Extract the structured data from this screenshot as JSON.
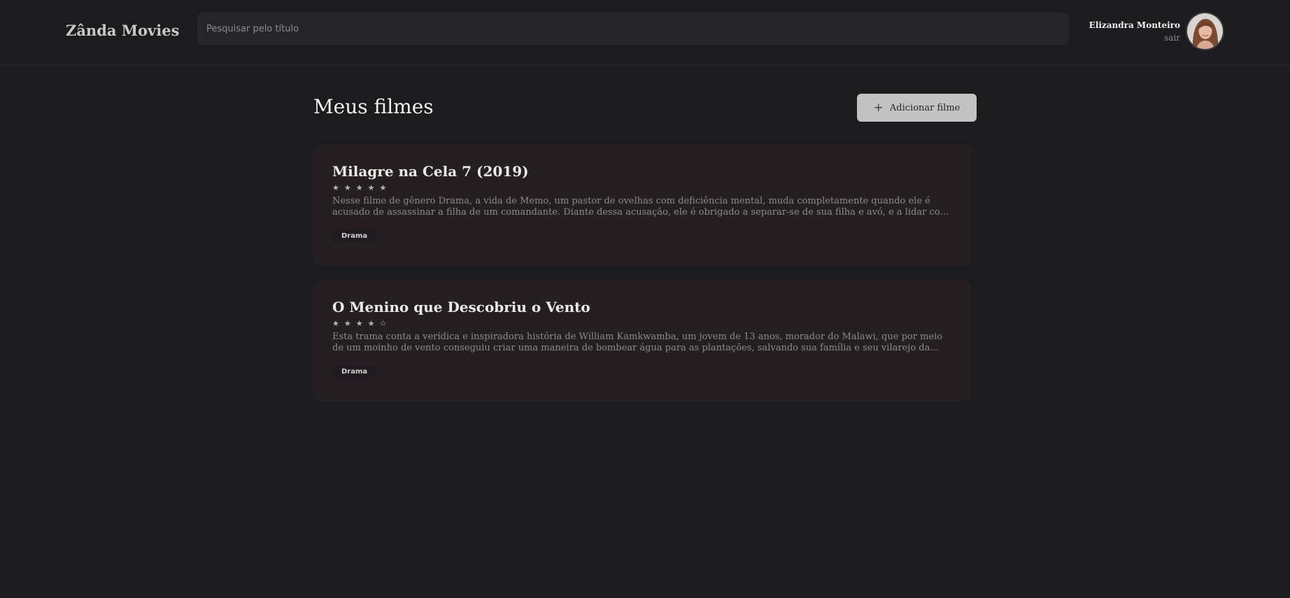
{
  "header": {
    "brand": "Zânda Movies",
    "search_placeholder": "Pesquisar pelo título",
    "search_value": "",
    "user_name": "Elizandra Monteiro",
    "signout_label": "sair"
  },
  "main": {
    "title": "Meus filmes",
    "add_button_label": "Adicionar filme",
    "movies": [
      {
        "title": "Milagre na Cela 7 (2019)",
        "rating": 5,
        "stars": "★★★★★",
        "description": "Nesse filme de gênero Drama, a vida de Memo, um pastor de ovelhas com deficiência mental, muda completamente quando ele é acusado de assassinar a filha de um comandante. Diante dessa acusação, ele é obrigado a separar-se de sua filha e avó, e a lidar com a sua condenação...",
        "tags": [
          "Drama"
        ]
      },
      {
        "title": "O Menino que Descobriu o Vento",
        "rating": 4,
        "stars": "★★★★☆",
        "description": "Esta trama conta a verídica e inspiradora história de William Kamkwamba, um jovem de 13 anos, morador do Malawi, que por meio de um moinho de vento conseguiu criar uma maneira de bombear água para as plantações, salvando sua família e seu vilarejo da fome. Este drama...",
        "tags": [
          "Drama"
        ]
      }
    ]
  },
  "icons": {
    "add": "plus-icon",
    "rating": "star-icon",
    "avatar": "avatar-photo"
  },
  "colors": {
    "background": "#1c1b1e",
    "card": "#261f21",
    "button": "#c3c2c2",
    "input": "#262529"
  }
}
